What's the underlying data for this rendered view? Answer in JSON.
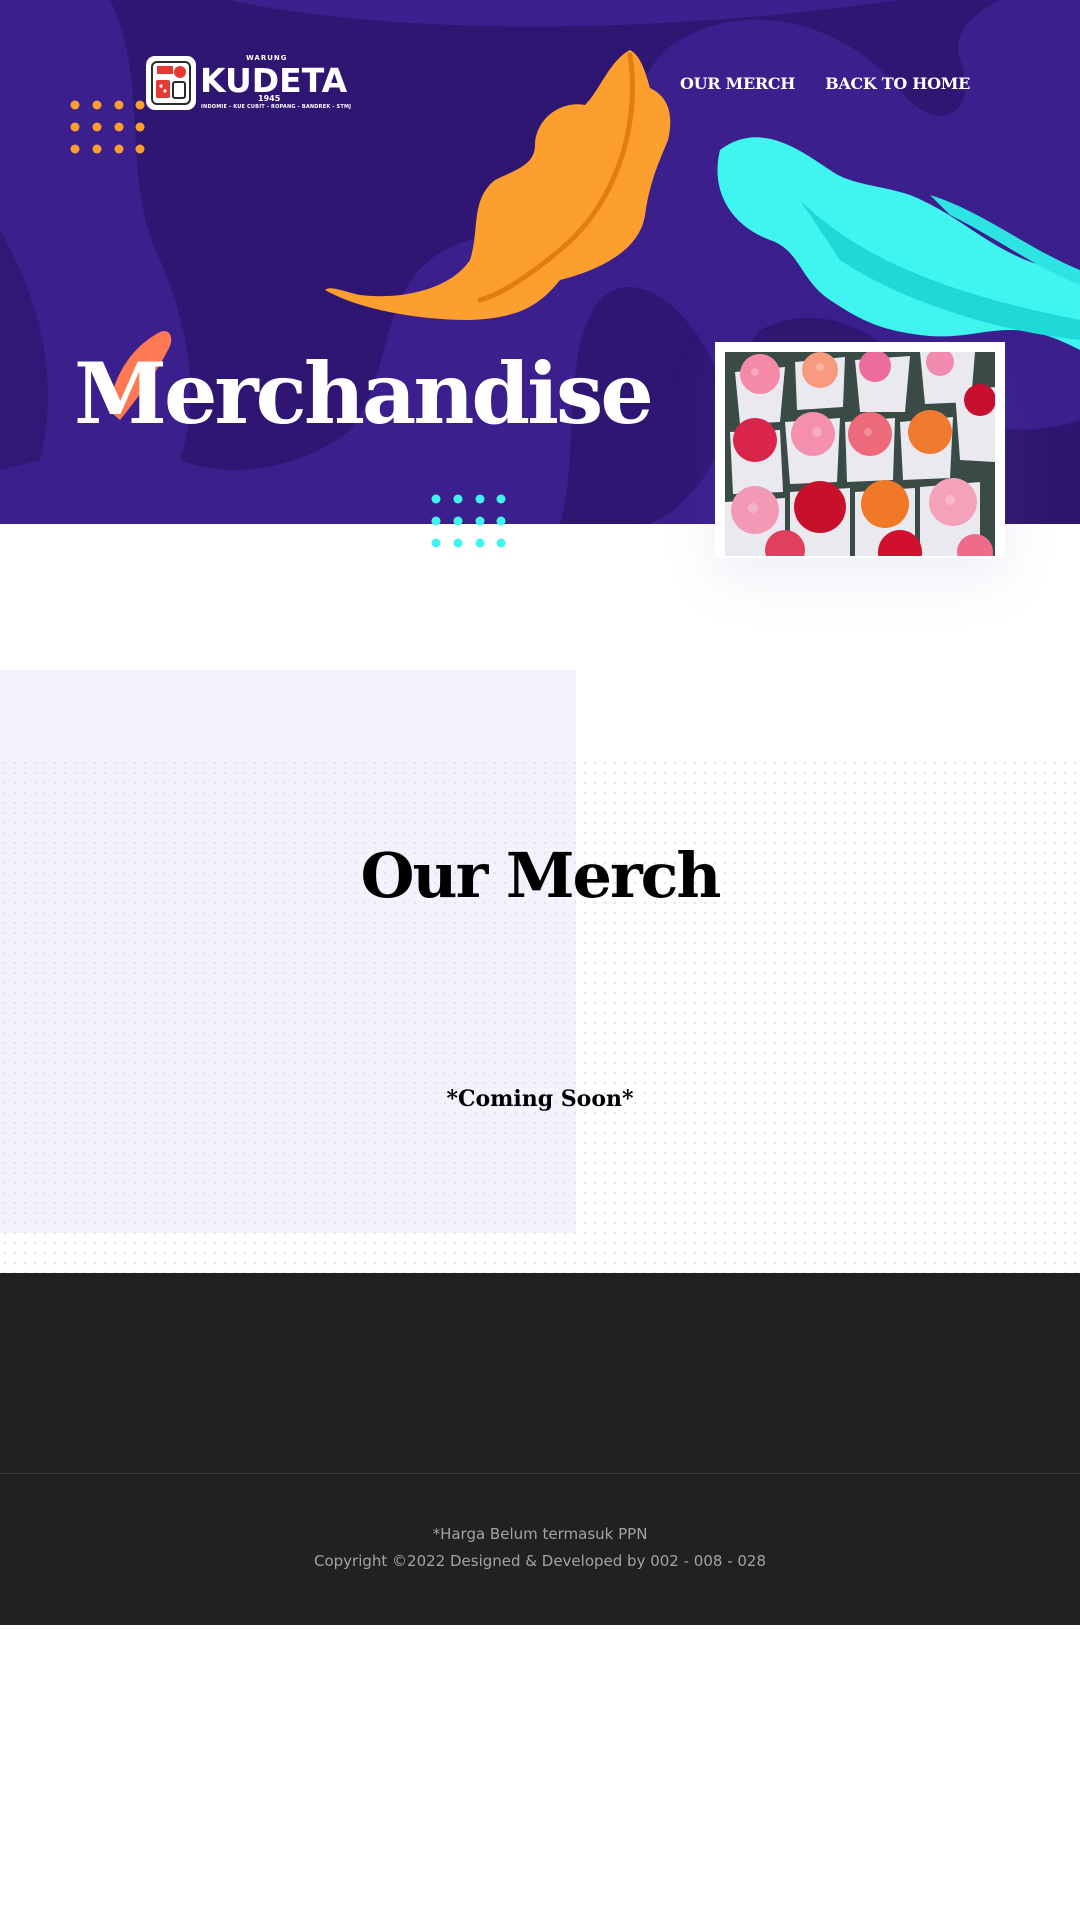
{
  "brand": {
    "name": "KUDETA",
    "top_text": "WARUNG",
    "year": "1945",
    "tagline": "INDOMIE - KUE CUBIT - ROPANG - BANDREK - STMJ"
  },
  "nav": {
    "items": [
      "OUR MERCH",
      "BACK TO HOME"
    ]
  },
  "hero": {
    "title": "Merchandise",
    "image_alt": "flower bouquets"
  },
  "merch": {
    "title": "Our Merch",
    "note": "*Coming Soon*"
  },
  "footer": {
    "price_note": "*Harga Belum termasuk PPN",
    "copyright": "Copyright ©2022 Designed & Developed by 002 - 008 - 028"
  },
  "colors": {
    "hero_purple": "#3a1f8e",
    "hero_dark_purple": "#321878",
    "leaf_orange": "#fd9f2f",
    "leaf_cyan": "#40f5ef",
    "leaf_coral": "#fe7a55",
    "footer_bg": "#212121"
  }
}
